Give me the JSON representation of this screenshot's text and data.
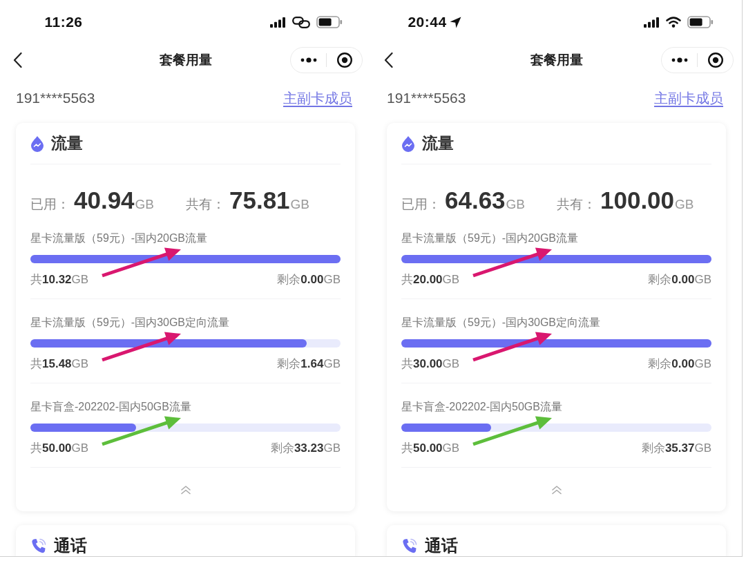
{
  "screens": [
    {
      "status_bar": {
        "time": "11:26",
        "location": false,
        "icons": [
          {
            "kind": "signal"
          },
          {
            "kind": "link"
          },
          {
            "kind": "battery"
          }
        ]
      },
      "nav": {
        "title": "套餐用量"
      },
      "account": {
        "phone": "191****5563",
        "link": "主副卡成员"
      },
      "data_card": {
        "title": "流量",
        "used_label": "已用：",
        "used_value": "40.94",
        "used_unit": "GB",
        "total_label": "共有：",
        "total_value": "75.81",
        "total_unit": "GB",
        "expanded": true,
        "plans": [
          {
            "name": "星卡流量版（59元）-国内20GB流量",
            "level": 1,
            "total": "共**10.32**GB",
            "remaining": "剩余**0.00**GB",
            "arrow": {
              "color": "#d9176f"
            }
          },
          {
            "name": "星卡流量版（59元）-国内30GB定向流量",
            "level": 0.89,
            "total": "共**15.48**GB",
            "remaining": "剩余**1.64**GB",
            "arrow": {
              "color": "#d9176f"
            }
          },
          {
            "name": "星卡盲盒-202202-国内50GB流量",
            "level": 0.34,
            "total": "共**50.00**GB",
            "remaining": "剩余**33.23**GB",
            "arrow": {
              "color": "#5dbe3b"
            }
          }
        ]
      },
      "calls_card": {
        "title": "通话"
      }
    },
    {
      "status_bar": {
        "time": "20:44",
        "location": true,
        "icons": [
          {
            "kind": "signal"
          },
          {
            "kind": "wifi"
          },
          {
            "kind": "battery"
          }
        ]
      },
      "nav": {
        "title": "套餐用量"
      },
      "account": {
        "phone": "191****5563",
        "link": "主副卡成员"
      },
      "data_card": {
        "title": "流量",
        "used_label": "已用：",
        "used_value": "64.63",
        "used_unit": "GB",
        "total_label": "共有：",
        "total_value": "100.00",
        "total_unit": "GB",
        "expanded": true,
        "plans": [
          {
            "name": "星卡流量版（59元）-国内20GB流量",
            "level": 1,
            "total": "共**20.00**GB",
            "remaining": "剩余**0.00**GB",
            "arrow": {
              "color": "#d9176f"
            }
          },
          {
            "name": "星卡流量版（59元）-国内30GB定向流量",
            "level": 1,
            "total": "共**30.00**GB",
            "remaining": "剩余**0.00**GB",
            "arrow": {
              "color": "#d9176f"
            }
          },
          {
            "name": "星卡盲盒-202202-国内50GB流量",
            "level": 0.29,
            "total": "共**50.00**GB",
            "remaining": "剩余**35.37**GB",
            "arrow": {
              "color": "#5dbe3b"
            }
          }
        ]
      },
      "calls_card": {
        "title": "通话"
      }
    }
  ]
}
